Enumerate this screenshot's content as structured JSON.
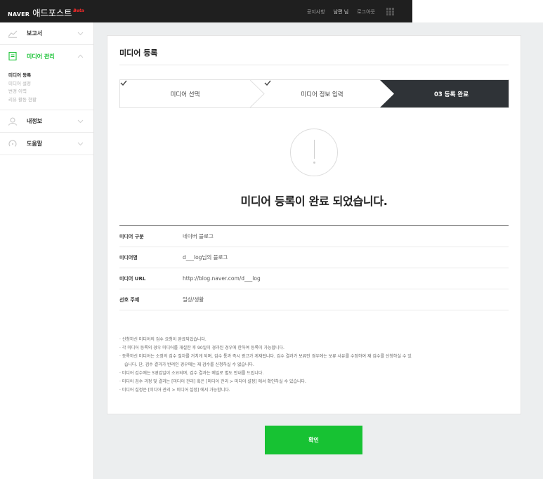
{
  "header": {
    "brand": "NAVER",
    "product": "애드포스트",
    "beta": "Beta",
    "nav": [
      "공지사항",
      "남편 님",
      "로그아웃"
    ]
  },
  "sidebar": {
    "items": [
      {
        "label": "보고서",
        "icon": "chart-line-icon"
      },
      {
        "label": "미디어 관리",
        "icon": "document-icon",
        "active": true
      },
      {
        "label": "내정보",
        "icon": "user-icon"
      },
      {
        "label": "도움말",
        "icon": "help-icon"
      }
    ],
    "submenu": [
      "미디어 등록",
      "미디어 설정",
      "변경 이력",
      "리뷰 활동 현황"
    ]
  },
  "page": {
    "title": "미디어 등록",
    "steps": [
      {
        "label": "미디어 선택",
        "state": "done"
      },
      {
        "label": "미디어 정보 입력",
        "state": "done"
      },
      {
        "label": "03 등록 완료",
        "state": "active"
      }
    ],
    "done_message": "미디어 등록이 완료 되었습니다.",
    "info": [
      {
        "key": "미디어 구분",
        "value": "네이버 블로그"
      },
      {
        "key": "미디어명",
        "value": "d___log님의 블로그"
      },
      {
        "key": "미디어 URL",
        "value": "http://blog.naver.com/d___log"
      },
      {
        "key": "선호 주제",
        "value": "일상/생활"
      }
    ],
    "notes": [
      "· 신청하신 미디어의 검수 요청이 완료되었습니다.",
      "· 각 미디어 등록의 경우 미디어를 개설한 후 90일이 경과된 경우에 한하여 등록이 가능합니다.",
      "· 등록하신 미디어는 소정의 검수 절차를 거치게 되며, 검수 통과 즉시 광고가 게재됩니다. 검수 결과가 보류인 경우에는 보류 사유를 수정하여 재 검수를 신청하실 수 있",
      "습니다. 단, 검수 결과가 반려인 경우에는 재 검수를 신청하실 수 없습니다.",
      "· 미디어 검수에는 5영업일이 소요되며, 검수 결과는 메일로 별도 안내를 드립니다.",
      "· 미디어 검수 과정 및 결과는 [미디어 관리] 혹은 [미디어 관리 > 미디어 설정] 에서 확인하실 수 있습니다.",
      "· 미디어 설정은 [미디어 관리 > 미디어 설정] 에서 가능합니다."
    ],
    "confirm_label": "확인"
  },
  "colors": {
    "accent": "#17c233",
    "header_bg": "#1f1f1f",
    "active_step_bg": "#2f3337"
  }
}
